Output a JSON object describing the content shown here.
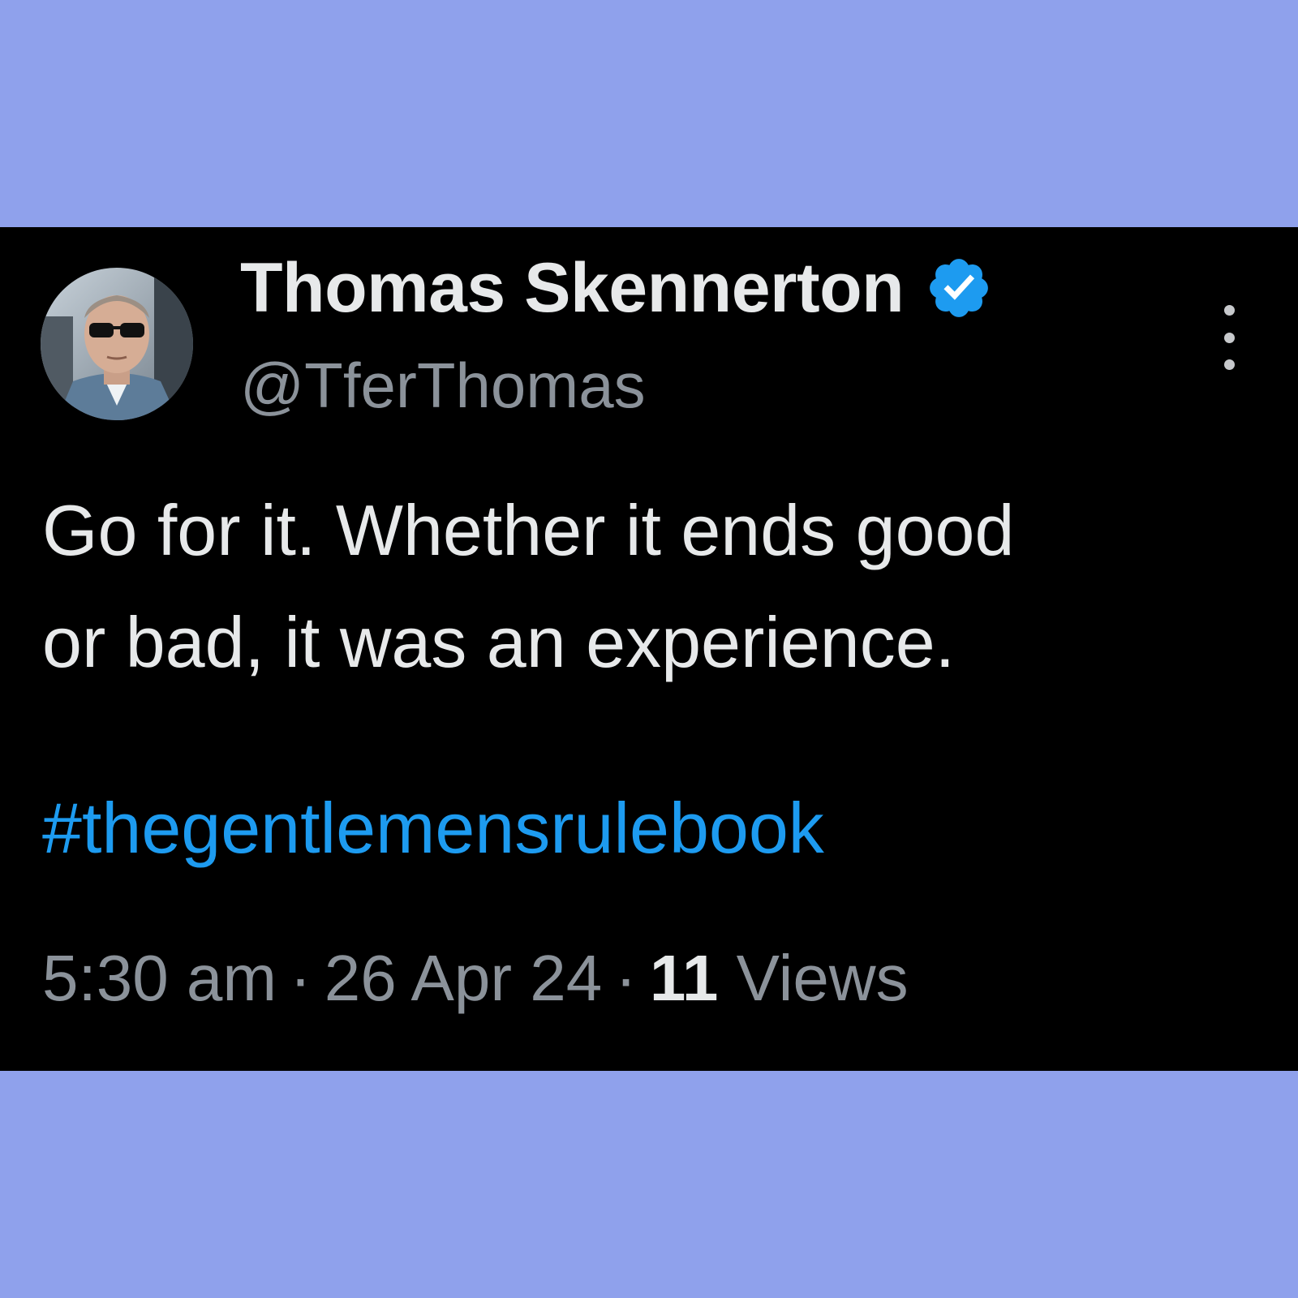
{
  "author": {
    "display_name": "Thomas Skennerton",
    "handle": "@TferThomas",
    "verified": true
  },
  "tweet": {
    "text_lines": [
      "Go for it.  Whether it ends good",
      "or bad, it was an experience."
    ],
    "hashtag": "#thegentlemensrulebook"
  },
  "meta": {
    "time": "5:30 am",
    "separator": "·",
    "date": "26 Apr 24",
    "views_count": "11",
    "views_label": "Views"
  },
  "icons": {
    "verified": "verified-badge-icon",
    "more": "more-options-icon"
  },
  "colors": {
    "page_background": "#8fa1ec",
    "card_background": "#000000",
    "primary_text": "#e7e9ea",
    "secondary_text": "#8b929a",
    "link": "#1d9bf0",
    "verified_badge": "#1d9bf0"
  }
}
